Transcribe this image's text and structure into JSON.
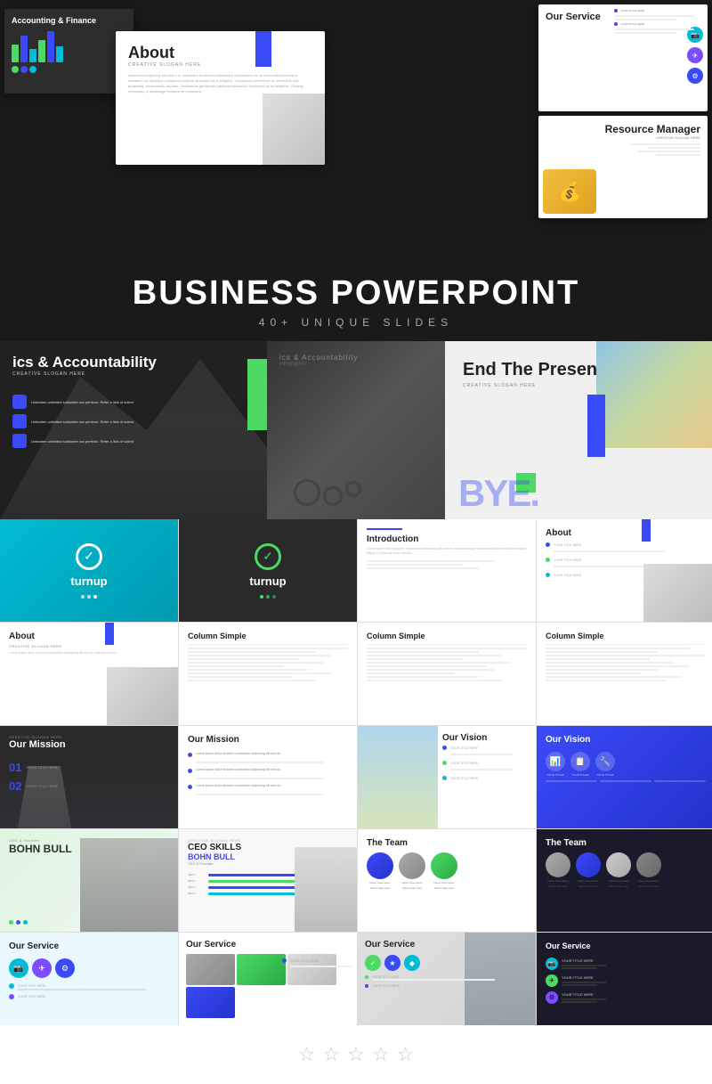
{
  "header": {
    "title": "BUSINESS POWERPOINT",
    "subtitle": "40+ UNIQUE SLIDES"
  },
  "slides": {
    "accounting": "Accounting & Finance",
    "about_main": "About",
    "about_sub": "CREATIVE SLOGAN HERE",
    "our_service": "Our Service",
    "resource_manager": "Resource Manager",
    "end_title": "End The Presentation",
    "end_sub": "CREATIVE SLOGAN HERE",
    "bye_text": "BYE.",
    "ethics_title": "ics & Accountability",
    "ethics_sub": "CREATIVE SLOGAN HERE",
    "introduction": "Introduction",
    "about_label": "About",
    "column_simple": "Column Simple",
    "our_mission_dark": "Our Mission",
    "our_mission": "Our Mission",
    "our_vision": "Our Vision",
    "the_team": "The Team",
    "ceo_skills": "CEO SKILLS",
    "bohn_name": "BOHN BULL",
    "bohn_role": "CEO & Founder",
    "logo_text": "turnup",
    "col_simple_bold": "Column",
    "col_simple_plain": " Simple"
  },
  "stars": [
    "☆",
    "☆",
    "☆",
    "☆",
    "☆"
  ],
  "colors": {
    "blue": "#3b4af8",
    "green": "#4cd964",
    "teal": "#00bcd4",
    "purple": "#7c4dff",
    "dark": "#1a1a1a"
  }
}
